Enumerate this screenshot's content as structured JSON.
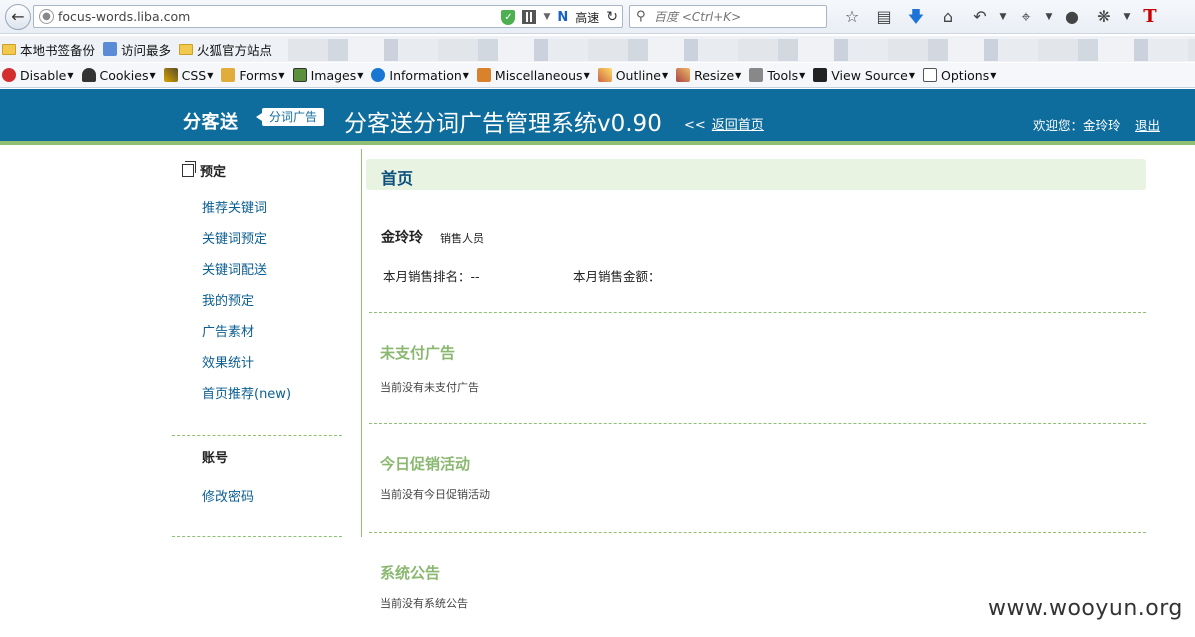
{
  "browser": {
    "url": "focus-words.liba.com",
    "speed_label": "高速",
    "search_placeholder": "百度 <Ctrl+K>",
    "bookmarks": [
      "本地书签备份",
      "访问最多",
      "火狐官方站点"
    ],
    "devbar": [
      "Disable",
      "Cookies",
      "CSS",
      "Forms",
      "Images",
      "Information",
      "Miscellaneous",
      "Outline",
      "Resize",
      "Tools",
      "View Source",
      "Options"
    ]
  },
  "header": {
    "logo": "分客送",
    "badge": "分词广告",
    "title": "分客送分词广告管理系统v0.90",
    "back_arrows": "<<",
    "back_home": "返回首页",
    "welcome": "欢迎您：金玲玲",
    "logout": "退出"
  },
  "sidebar": {
    "section_title": "预定",
    "links": [
      "推荐关键词",
      "关键词预定",
      "关键词配送",
      "我的预定",
      "广告素材",
      "效果统计",
      "首页推荐(new)"
    ],
    "account_title": "账号",
    "account_link": "修改密码"
  },
  "main": {
    "page_title": "首页",
    "user_name": "金玲玲",
    "user_role": "销售人员",
    "rank_label": "本月销售排名：--",
    "amount_label": "本月销售金额：",
    "sections": [
      {
        "title": "未支付广告",
        "text": "当前没有未支付广告"
      },
      {
        "title": "今日促销活动",
        "text": "当前没有今日促销活动"
      },
      {
        "title": "系统公告",
        "text": "当前没有系统公告"
      }
    ]
  },
  "watermark": "www.wooyun.org"
}
